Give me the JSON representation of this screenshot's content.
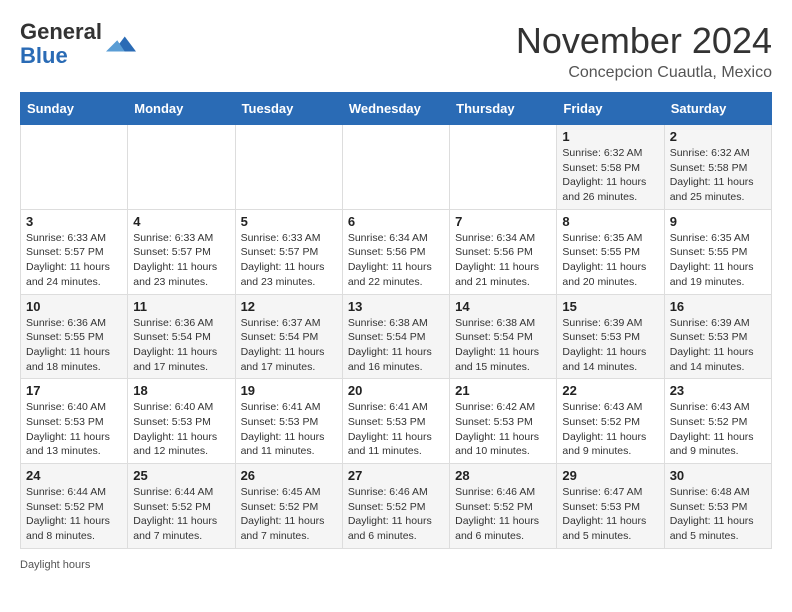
{
  "header": {
    "logo_general": "General",
    "logo_blue": "Blue",
    "month_title": "November 2024",
    "location": "Concepcion Cuautla, Mexico"
  },
  "days_of_week": [
    "Sunday",
    "Monday",
    "Tuesday",
    "Wednesday",
    "Thursday",
    "Friday",
    "Saturday"
  ],
  "weeks": [
    [
      {
        "day": "",
        "info": ""
      },
      {
        "day": "",
        "info": ""
      },
      {
        "day": "",
        "info": ""
      },
      {
        "day": "",
        "info": ""
      },
      {
        "day": "",
        "info": ""
      },
      {
        "day": "1",
        "info": "Sunrise: 6:32 AM\nSunset: 5:58 PM\nDaylight: 11 hours and 26 minutes."
      },
      {
        "day": "2",
        "info": "Sunrise: 6:32 AM\nSunset: 5:58 PM\nDaylight: 11 hours and 25 minutes."
      }
    ],
    [
      {
        "day": "3",
        "info": "Sunrise: 6:33 AM\nSunset: 5:57 PM\nDaylight: 11 hours and 24 minutes."
      },
      {
        "day": "4",
        "info": "Sunrise: 6:33 AM\nSunset: 5:57 PM\nDaylight: 11 hours and 23 minutes."
      },
      {
        "day": "5",
        "info": "Sunrise: 6:33 AM\nSunset: 5:57 PM\nDaylight: 11 hours and 23 minutes."
      },
      {
        "day": "6",
        "info": "Sunrise: 6:34 AM\nSunset: 5:56 PM\nDaylight: 11 hours and 22 minutes."
      },
      {
        "day": "7",
        "info": "Sunrise: 6:34 AM\nSunset: 5:56 PM\nDaylight: 11 hours and 21 minutes."
      },
      {
        "day": "8",
        "info": "Sunrise: 6:35 AM\nSunset: 5:55 PM\nDaylight: 11 hours and 20 minutes."
      },
      {
        "day": "9",
        "info": "Sunrise: 6:35 AM\nSunset: 5:55 PM\nDaylight: 11 hours and 19 minutes."
      }
    ],
    [
      {
        "day": "10",
        "info": "Sunrise: 6:36 AM\nSunset: 5:55 PM\nDaylight: 11 hours and 18 minutes."
      },
      {
        "day": "11",
        "info": "Sunrise: 6:36 AM\nSunset: 5:54 PM\nDaylight: 11 hours and 17 minutes."
      },
      {
        "day": "12",
        "info": "Sunrise: 6:37 AM\nSunset: 5:54 PM\nDaylight: 11 hours and 17 minutes."
      },
      {
        "day": "13",
        "info": "Sunrise: 6:38 AM\nSunset: 5:54 PM\nDaylight: 11 hours and 16 minutes."
      },
      {
        "day": "14",
        "info": "Sunrise: 6:38 AM\nSunset: 5:54 PM\nDaylight: 11 hours and 15 minutes."
      },
      {
        "day": "15",
        "info": "Sunrise: 6:39 AM\nSunset: 5:53 PM\nDaylight: 11 hours and 14 minutes."
      },
      {
        "day": "16",
        "info": "Sunrise: 6:39 AM\nSunset: 5:53 PM\nDaylight: 11 hours and 14 minutes."
      }
    ],
    [
      {
        "day": "17",
        "info": "Sunrise: 6:40 AM\nSunset: 5:53 PM\nDaylight: 11 hours and 13 minutes."
      },
      {
        "day": "18",
        "info": "Sunrise: 6:40 AM\nSunset: 5:53 PM\nDaylight: 11 hours and 12 minutes."
      },
      {
        "day": "19",
        "info": "Sunrise: 6:41 AM\nSunset: 5:53 PM\nDaylight: 11 hours and 11 minutes."
      },
      {
        "day": "20",
        "info": "Sunrise: 6:41 AM\nSunset: 5:53 PM\nDaylight: 11 hours and 11 minutes."
      },
      {
        "day": "21",
        "info": "Sunrise: 6:42 AM\nSunset: 5:53 PM\nDaylight: 11 hours and 10 minutes."
      },
      {
        "day": "22",
        "info": "Sunrise: 6:43 AM\nSunset: 5:52 PM\nDaylight: 11 hours and 9 minutes."
      },
      {
        "day": "23",
        "info": "Sunrise: 6:43 AM\nSunset: 5:52 PM\nDaylight: 11 hours and 9 minutes."
      }
    ],
    [
      {
        "day": "24",
        "info": "Sunrise: 6:44 AM\nSunset: 5:52 PM\nDaylight: 11 hours and 8 minutes."
      },
      {
        "day": "25",
        "info": "Sunrise: 6:44 AM\nSunset: 5:52 PM\nDaylight: 11 hours and 7 minutes."
      },
      {
        "day": "26",
        "info": "Sunrise: 6:45 AM\nSunset: 5:52 PM\nDaylight: 11 hours and 7 minutes."
      },
      {
        "day": "27",
        "info": "Sunrise: 6:46 AM\nSunset: 5:52 PM\nDaylight: 11 hours and 6 minutes."
      },
      {
        "day": "28",
        "info": "Sunrise: 6:46 AM\nSunset: 5:52 PM\nDaylight: 11 hours and 6 minutes."
      },
      {
        "day": "29",
        "info": "Sunrise: 6:47 AM\nSunset: 5:53 PM\nDaylight: 11 hours and 5 minutes."
      },
      {
        "day": "30",
        "info": "Sunrise: 6:48 AM\nSunset: 5:53 PM\nDaylight: 11 hours and 5 minutes."
      }
    ]
  ],
  "footer": {
    "daylight_label": "Daylight hours"
  }
}
